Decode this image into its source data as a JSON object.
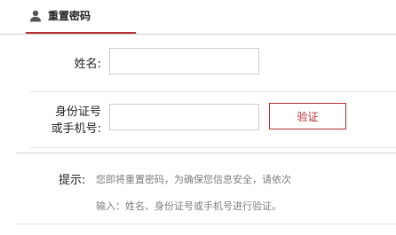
{
  "header": {
    "title": "重置密码",
    "icon": "user-icon",
    "accent_color": "#b42f33"
  },
  "form": {
    "name_label": "姓名:",
    "name_value": "",
    "id_label_line1": "身份证号",
    "id_label_line2": "或手机号:",
    "id_value": "",
    "verify_button_label": "验证"
  },
  "tips": {
    "label": "提示:",
    "line1": "您即将重置密码，为确保您信息安全，请依次",
    "line2": "输入：姓名、身份证号或手机号进行验证。"
  }
}
